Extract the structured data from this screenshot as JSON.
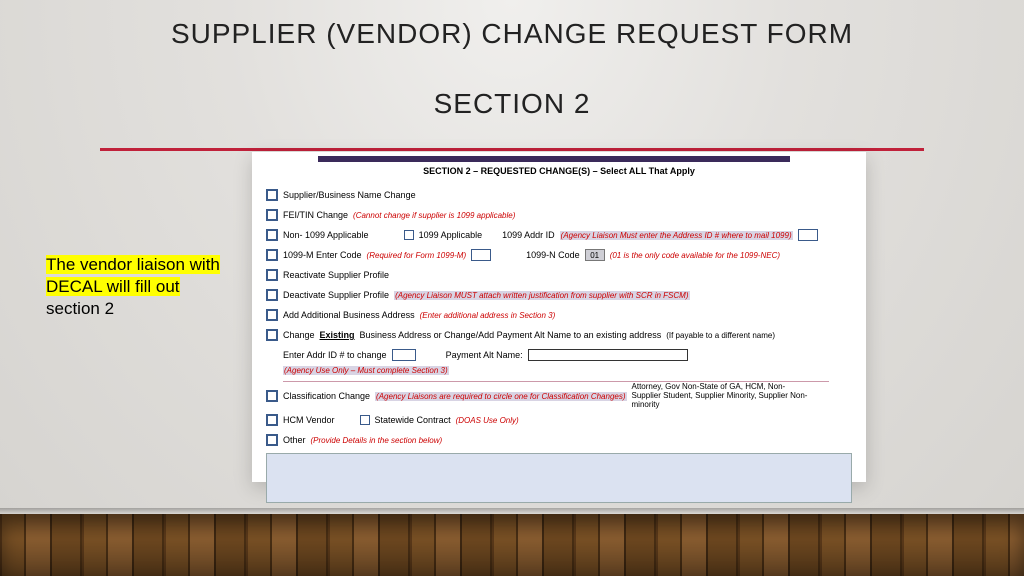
{
  "slide": {
    "title": "SUPPLIER (VENDOR) CHANGE REQUEST FORM",
    "subtitle": "SECTION 2",
    "annotation_line1": "The vendor liaison with",
    "annotation_line2": "DECAL will fill out",
    "annotation_line3": "section 2"
  },
  "form": {
    "section_heading": "SECTION 2 – REQUESTED CHANGE(S) – Select ALL That Apply",
    "r1": {
      "label": "Supplier/Business Name Change"
    },
    "r2": {
      "label": "FEI/TIN Change",
      "note": "(Cannot change if supplier is 1099 applicable)"
    },
    "r3": {
      "label_a": "Non- 1099 Applicable",
      "label_b": "1099 Applicable",
      "label_c": "1099 Addr ID",
      "note_c": "(Agency Liaison Must enter the Address ID # where to mail 1099)"
    },
    "r4": {
      "label_a": "1099-M   Enter Code",
      "note_a": "(Required for Form 1099-M)",
      "label_b": "1099-N   Code",
      "code_b": "01",
      "note_b": "(01 is the only code available for the 1099-NEC)"
    },
    "r5": {
      "label": "Reactivate Supplier Profile"
    },
    "r6": {
      "label": "Deactivate Supplier Profile",
      "note": "(Agency Liaison MUST attach written justification from supplier with SCR in FSCM)"
    },
    "r7": {
      "label": "Add Additional Business Address",
      "note": "(Enter additional address in Section 3)"
    },
    "r8": {
      "label_a": "Change",
      "label_b": "Existing",
      "label_c": "Business Address or Change/Add Payment Alt Name to an existing address",
      "tail": "(If payable to a different name)"
    },
    "r9": {
      "label_a": "Enter Addr ID # to change",
      "note_a": "(Agency Use Only – Must complete Section 3)",
      "label_b": "Payment Alt Name:"
    },
    "r10": {
      "label": "Classification Change",
      "note": "(Agency Liaisons are required to circle one for Classification Changes)",
      "right": "Attorney, Gov Non-State of GA,  HCM,  Non-Supplier Student, Supplier Minority, Supplier Non-minority"
    },
    "r11": {
      "label_a": "HCM Vendor",
      "label_b": "Statewide Contract",
      "note_b": "(DOAS Use Only)"
    },
    "r12": {
      "label": "Other",
      "note": "(Provide Details in the section below)"
    }
  }
}
